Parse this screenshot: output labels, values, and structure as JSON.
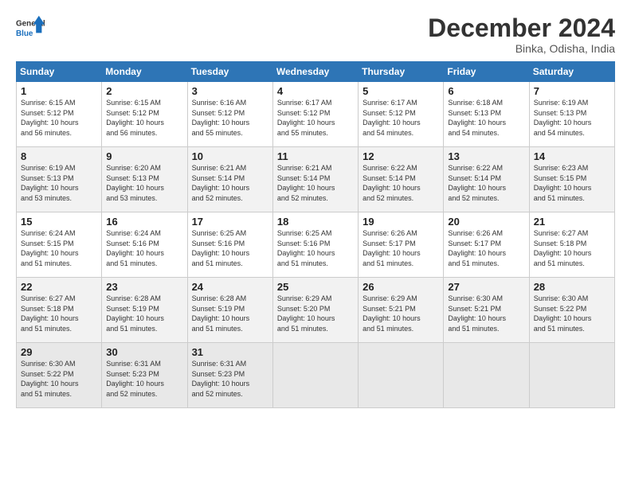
{
  "header": {
    "logo_line1": "General",
    "logo_line2": "Blue",
    "month": "December 2024",
    "location": "Binka, Odisha, India"
  },
  "weekdays": [
    "Sunday",
    "Monday",
    "Tuesday",
    "Wednesday",
    "Thursday",
    "Friday",
    "Saturday"
  ],
  "weeks": [
    [
      {
        "day": "1",
        "detail": "Sunrise: 6:15 AM\nSunset: 5:12 PM\nDaylight: 10 hours\nand 56 minutes."
      },
      {
        "day": "2",
        "detail": "Sunrise: 6:15 AM\nSunset: 5:12 PM\nDaylight: 10 hours\nand 56 minutes."
      },
      {
        "day": "3",
        "detail": "Sunrise: 6:16 AM\nSunset: 5:12 PM\nDaylight: 10 hours\nand 55 minutes."
      },
      {
        "day": "4",
        "detail": "Sunrise: 6:17 AM\nSunset: 5:12 PM\nDaylight: 10 hours\nand 55 minutes."
      },
      {
        "day": "5",
        "detail": "Sunrise: 6:17 AM\nSunset: 5:12 PM\nDaylight: 10 hours\nand 54 minutes."
      },
      {
        "day": "6",
        "detail": "Sunrise: 6:18 AM\nSunset: 5:13 PM\nDaylight: 10 hours\nand 54 minutes."
      },
      {
        "day": "7",
        "detail": "Sunrise: 6:19 AM\nSunset: 5:13 PM\nDaylight: 10 hours\nand 54 minutes."
      }
    ],
    [
      {
        "day": "8",
        "detail": "Sunrise: 6:19 AM\nSunset: 5:13 PM\nDaylight: 10 hours\nand 53 minutes."
      },
      {
        "day": "9",
        "detail": "Sunrise: 6:20 AM\nSunset: 5:13 PM\nDaylight: 10 hours\nand 53 minutes."
      },
      {
        "day": "10",
        "detail": "Sunrise: 6:21 AM\nSunset: 5:14 PM\nDaylight: 10 hours\nand 52 minutes."
      },
      {
        "day": "11",
        "detail": "Sunrise: 6:21 AM\nSunset: 5:14 PM\nDaylight: 10 hours\nand 52 minutes."
      },
      {
        "day": "12",
        "detail": "Sunrise: 6:22 AM\nSunset: 5:14 PM\nDaylight: 10 hours\nand 52 minutes."
      },
      {
        "day": "13",
        "detail": "Sunrise: 6:22 AM\nSunset: 5:14 PM\nDaylight: 10 hours\nand 52 minutes."
      },
      {
        "day": "14",
        "detail": "Sunrise: 6:23 AM\nSunset: 5:15 PM\nDaylight: 10 hours\nand 51 minutes."
      }
    ],
    [
      {
        "day": "15",
        "detail": "Sunrise: 6:24 AM\nSunset: 5:15 PM\nDaylight: 10 hours\nand 51 minutes."
      },
      {
        "day": "16",
        "detail": "Sunrise: 6:24 AM\nSunset: 5:16 PM\nDaylight: 10 hours\nand 51 minutes."
      },
      {
        "day": "17",
        "detail": "Sunrise: 6:25 AM\nSunset: 5:16 PM\nDaylight: 10 hours\nand 51 minutes."
      },
      {
        "day": "18",
        "detail": "Sunrise: 6:25 AM\nSunset: 5:16 PM\nDaylight: 10 hours\nand 51 minutes."
      },
      {
        "day": "19",
        "detail": "Sunrise: 6:26 AM\nSunset: 5:17 PM\nDaylight: 10 hours\nand 51 minutes."
      },
      {
        "day": "20",
        "detail": "Sunrise: 6:26 AM\nSunset: 5:17 PM\nDaylight: 10 hours\nand 51 minutes."
      },
      {
        "day": "21",
        "detail": "Sunrise: 6:27 AM\nSunset: 5:18 PM\nDaylight: 10 hours\nand 51 minutes."
      }
    ],
    [
      {
        "day": "22",
        "detail": "Sunrise: 6:27 AM\nSunset: 5:18 PM\nDaylight: 10 hours\nand 51 minutes."
      },
      {
        "day": "23",
        "detail": "Sunrise: 6:28 AM\nSunset: 5:19 PM\nDaylight: 10 hours\nand 51 minutes."
      },
      {
        "day": "24",
        "detail": "Sunrise: 6:28 AM\nSunset: 5:19 PM\nDaylight: 10 hours\nand 51 minutes."
      },
      {
        "day": "25",
        "detail": "Sunrise: 6:29 AM\nSunset: 5:20 PM\nDaylight: 10 hours\nand 51 minutes."
      },
      {
        "day": "26",
        "detail": "Sunrise: 6:29 AM\nSunset: 5:21 PM\nDaylight: 10 hours\nand 51 minutes."
      },
      {
        "day": "27",
        "detail": "Sunrise: 6:30 AM\nSunset: 5:21 PM\nDaylight: 10 hours\nand 51 minutes."
      },
      {
        "day": "28",
        "detail": "Sunrise: 6:30 AM\nSunset: 5:22 PM\nDaylight: 10 hours\nand 51 minutes."
      }
    ],
    [
      {
        "day": "29",
        "detail": "Sunrise: 6:30 AM\nSunset: 5:22 PM\nDaylight: 10 hours\nand 51 minutes."
      },
      {
        "day": "30",
        "detail": "Sunrise: 6:31 AM\nSunset: 5:23 PM\nDaylight: 10 hours\nand 52 minutes."
      },
      {
        "day": "31",
        "detail": "Sunrise: 6:31 AM\nSunset: 5:23 PM\nDaylight: 10 hours\nand 52 minutes."
      },
      {
        "day": "",
        "detail": ""
      },
      {
        "day": "",
        "detail": ""
      },
      {
        "day": "",
        "detail": ""
      },
      {
        "day": "",
        "detail": ""
      }
    ]
  ]
}
